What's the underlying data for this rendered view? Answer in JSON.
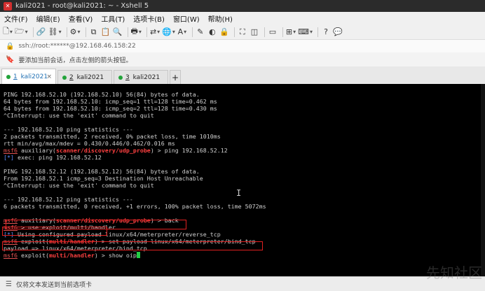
{
  "window": {
    "title": "kali2021 - root@kali2021: ~ - Xshell 5"
  },
  "menu": [
    "文件(F)",
    "编辑(E)",
    "查看(V)",
    "工具(T)",
    "选项卡(B)",
    "窗口(W)",
    "帮助(H)"
  ],
  "address": {
    "text": "ssh://root:******@192.168.46.158:22"
  },
  "hint": {
    "text": "要添加当前会话，点击左侧的箭头按钮。"
  },
  "tabs": [
    {
      "num": "1",
      "name": "kali2021",
      "active": true
    },
    {
      "num": "2",
      "name": "kali2021",
      "active": false
    },
    {
      "num": "3",
      "name": "kali2021",
      "active": false
    }
  ],
  "tab_plus": "+",
  "tab_close": "×",
  "terminal": {
    "lines": [
      [
        {
          "t": "PING 192.168.52.10 (192.168.52.10) 56(84) bytes of data."
        }
      ],
      [
        {
          "t": "64 bytes from 192.168.52.10: icmp_seq=1 ttl=128 time=0.462 ms"
        }
      ],
      [
        {
          "t": "64 bytes from 192.168.52.10: icmp_seq=2 ttl=128 time=0.430 ms"
        }
      ],
      [
        {
          "t": "^CInterrupt: use the 'exit' command to quit"
        }
      ],
      [
        {
          "t": ""
        }
      ],
      [
        {
          "t": "--- 192.168.52.10 ping statistics ---"
        }
      ],
      [
        {
          "t": "2 packets transmitted, 2 received, 0% packet loss, time 1010ms"
        }
      ],
      [
        {
          "t": "rtt min/avg/max/mdev = 0.430/0.446/0.462/0.016 ms"
        }
      ],
      [
        {
          "t": "msf6",
          "c": "ru"
        },
        {
          "t": " auxiliary("
        },
        {
          "t": "scanner/discovery/udp_probe",
          "c": "rb"
        },
        {
          "t": ") > ping 192.168.52.12"
        }
      ],
      [
        {
          "t": "[*]",
          "c": "blu"
        },
        {
          "t": " exec: ping 192.168.52.12"
        }
      ],
      [
        {
          "t": ""
        }
      ],
      [
        {
          "t": "PING 192.168.52.12 (192.168.52.12) 56(84) bytes of data."
        }
      ],
      [
        {
          "t": "From 192.168.52.1 icmp_seq=3 Destination Host Unreachable"
        }
      ],
      [
        {
          "t": "^CInterrupt: use the 'exit' command to quit"
        }
      ],
      [
        {
          "t": ""
        }
      ],
      [
        {
          "t": "--- 192.168.52.12 ping statistics ---"
        }
      ],
      [
        {
          "t": "6 packets transmitted, 0 received, +1 errors, 100% packet loss, time 5072ms"
        }
      ],
      [
        {
          "t": ""
        }
      ],
      [
        {
          "t": "msf6",
          "c": "ru"
        },
        {
          "t": " auxiliary("
        },
        {
          "t": "scanner/discovery/udp_probe",
          "c": "rb"
        },
        {
          "t": ") > back"
        }
      ],
      [
        {
          "t": "msf6",
          "c": "ru"
        },
        {
          "t": " > use exploit/multi/handler"
        }
      ],
      [
        {
          "t": "[*]",
          "c": "blu"
        },
        {
          "t": " Using configured payload linux/x64/meterpreter/reverse_tcp"
        }
      ],
      [
        {
          "t": "msf6",
          "c": "ru"
        },
        {
          "t": " exploit("
        },
        {
          "t": "multi/handler",
          "c": "rb"
        },
        {
          "t": ") > set payload linux/x64/meterpreter/bind_tcp"
        }
      ],
      [
        {
          "t": "payload => linux/x64/meterpreter/bind_tcp"
        }
      ],
      [
        {
          "t": "msf6",
          "c": "ru"
        },
        {
          "t": " exploit("
        },
        {
          "t": "multi/handler",
          "c": "rb"
        },
        {
          "t": ") > show oip"
        }
      ]
    ]
  },
  "status": {
    "text": "仅将文本发送到当前选项卡"
  },
  "watermark": {
    "text": "先知社区"
  },
  "icons": [
    "new-session-icon",
    "open-folder-icon",
    "link-icon",
    "disconnect-icon",
    "properties-icon",
    "copy-icon",
    "paste-icon",
    "find-icon",
    "print-icon",
    "transfer-icon",
    "globe-icon",
    "font-icon",
    "script-icon",
    "color-icon",
    "lock-icon",
    "fullscreen-icon",
    "transparency-icon",
    "compose-icon",
    "add-tab-icon",
    "keyboard-icon",
    "help-icon",
    "speech-icon"
  ],
  "colors": {
    "terminal_bg": "#000000",
    "prompt_red": "#e05050",
    "info_blue": "#5b8cff",
    "highlight_box": "#e02020",
    "cursor": "#22cc44"
  }
}
